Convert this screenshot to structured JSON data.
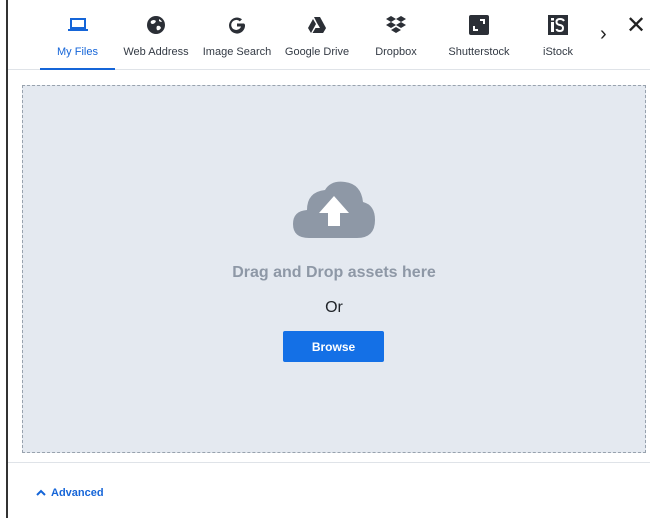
{
  "tabs": [
    {
      "label": "My Files",
      "icon": "laptop-icon",
      "active": true
    },
    {
      "label": "Web Address",
      "icon": "globe-icon",
      "active": false
    },
    {
      "label": "Image Search",
      "icon": "google-icon",
      "active": false
    },
    {
      "label": "Google Drive",
      "icon": "google-drive-icon",
      "active": false
    },
    {
      "label": "Dropbox",
      "icon": "dropbox-icon",
      "active": false
    },
    {
      "label": "Shutterstock",
      "icon": "shutterstock-icon",
      "active": false
    },
    {
      "label": "iStock",
      "icon": "istock-icon",
      "active": false
    }
  ],
  "nav": {
    "more_glyph": "›",
    "close_glyph": "✕"
  },
  "dropzone": {
    "title": "Drag and Drop assets here",
    "or_text": "Or",
    "browse_label": "Browse"
  },
  "footer": {
    "advanced_label": "Advanced"
  },
  "colors": {
    "accent": "#1565d8",
    "button": "#1470e6",
    "dropzone_bg": "#e4e9f0",
    "cloud": "#8e98a6"
  }
}
